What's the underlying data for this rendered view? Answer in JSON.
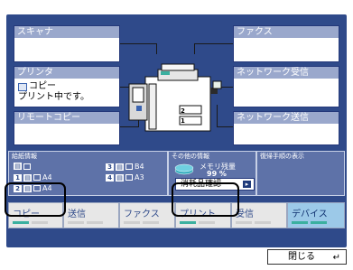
{
  "boxes": {
    "scanner": "スキャナ",
    "fax": "ファクス",
    "printer": {
      "title": "プリンタ",
      "line1": "コピー",
      "line2": "プリント中です。"
    },
    "network_receive": "ネットワーク受信",
    "remote_copy": "リモートコピー",
    "network_send": "ネットワーク送信"
  },
  "info": {
    "paper_info_title": "給紙情報",
    "paper_rows": [
      {
        "tray": "",
        "size": ""
      },
      {
        "tray": "3",
        "size": "B4"
      },
      {
        "tray": "1",
        "size": "A4"
      },
      {
        "tray": "4",
        "size": "A3"
      },
      {
        "tray": "2",
        "size": "A4"
      }
    ],
    "other_info_title": "その他の情報",
    "memory_label": "メモリ残量",
    "memory_value": "99 %",
    "consumables_button": "消耗品確認",
    "recovery_title": "復帰手順の表示"
  },
  "tabs": [
    {
      "label": "コピー"
    },
    {
      "label": "送信"
    },
    {
      "label": "ファクス"
    },
    {
      "label": "プリント"
    },
    {
      "label": "受信"
    },
    {
      "label": "デバイス"
    }
  ],
  "close_button": "閉じる",
  "machine_labels": [
    "2",
    "1"
  ],
  "colors": {
    "panel": "#2f4a8a",
    "box_header": "#9aa8cc",
    "status_green": "#3bb0a0",
    "device_tab": "#9cc9e8"
  }
}
